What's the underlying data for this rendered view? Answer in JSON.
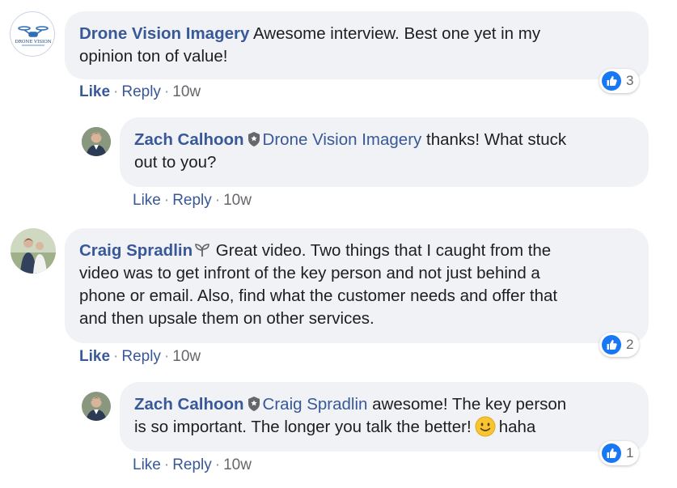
{
  "comments": [
    {
      "author": "Drone Vision Imagery",
      "text": "Awesome interview. Best one yet in my opinion ton of value!",
      "text_line1": "Awesome interview. Best one yet in my",
      "text_line2": "opinion ton of value!",
      "avatar_label": "DRONE VISION",
      "actions": {
        "like": "Like",
        "reply": "Reply",
        "time": "10w"
      },
      "reaction_count": "3"
    },
    {
      "author": "Zach Calhoon",
      "mention": "Drone Vision Imagery",
      "text_line1": " thanks! What stuck",
      "text_line2": "out to you?",
      "actions": {
        "like": "Like",
        "reply": "Reply",
        "time": "10w"
      }
    },
    {
      "author": "Craig Spradlin",
      "text_line1": " Great video. Two things that I caught from the",
      "text_line2": "video was to get infront of the key person and not just behind a",
      "text_line3": "phone or email. Also, find what the customer needs and offer that",
      "text_line4": "and then upsale them on other services.",
      "actions": {
        "like": "Like",
        "reply": "Reply",
        "time": "10w"
      },
      "reaction_count": "2"
    },
    {
      "author": "Zach Calhoon",
      "mention": "Craig Spradlin",
      "text_line1": " awesome! The key person",
      "text_line2": "is so important. The longer you talk the better!",
      "text_line2_after_emoji": "haha",
      "actions": {
        "like": "Like",
        "reply": "Reply",
        "time": "10w"
      },
      "reaction_count": "1"
    }
  ],
  "colors": {
    "link": "#385898",
    "bubble": "#f0f2f5",
    "like_blue": "#1877f2",
    "meta": "#65676b"
  },
  "icons": [
    "shield-icon",
    "sprout-icon",
    "thumbs-up-icon",
    "slightly-smiling-emoji"
  ]
}
